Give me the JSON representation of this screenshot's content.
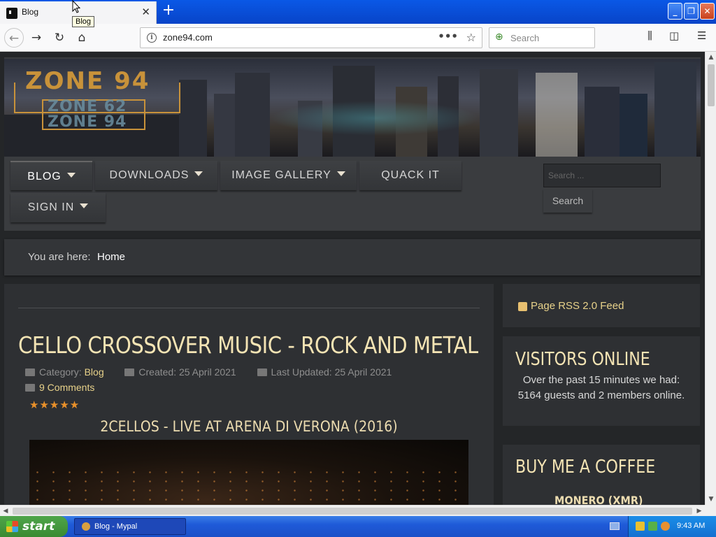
{
  "browser": {
    "tab_title": "Blog",
    "tooltip": "Blog",
    "url": "zone94.com",
    "search_placeholder": "Search"
  },
  "site": {
    "logo_main": "ZONE 94",
    "logo_sub_line1": "ZONE 62",
    "logo_sub_line2": "ZONE 94",
    "menu": [
      {
        "label": "BLOG",
        "has_caret": true,
        "active": true
      },
      {
        "label": "DOWNLOADS",
        "has_caret": true
      },
      {
        "label": "IMAGE GALLERY",
        "has_caret": true
      },
      {
        "label": "QUACK IT",
        "has_caret": false
      },
      {
        "label": "SIGN IN",
        "has_caret": true
      }
    ],
    "search_placeholder": "Search ...",
    "search_button": "Search"
  },
  "breadcrumb": {
    "label": "You are here:",
    "home": "Home"
  },
  "article": {
    "title": "CELLO CROSSOVER MUSIC - ROCK AND METAL",
    "category_label": "Category:",
    "category": "Blog",
    "created": "Created: 25 April 2021",
    "updated": "Last Updated: 25 April 2021",
    "comments": "9 Comments",
    "rating": "★★★★★",
    "rating_value": 5,
    "rating_max": 5,
    "video_title": "2CELLOS - LIVE AT ARENA DI VERONA (2016)"
  },
  "sidebar": {
    "rss": "Page RSS 2.0 Feed",
    "visitors_title": "VISITORS ONLINE",
    "visitors_text": "Over the past 15 minutes we had: 5164 guests and 2 members online.",
    "coffee_title": "BUY ME A COFFEE",
    "monero": "MONERO (XMR)"
  },
  "taskbar": {
    "start": "start",
    "task": "Blog - Mypal",
    "clock": "9:43 AM"
  },
  "colors": {
    "accent_gold": "#f4e4b4",
    "link": "#e8d28a",
    "panel": "#2e3033",
    "star": "#e8902a"
  }
}
